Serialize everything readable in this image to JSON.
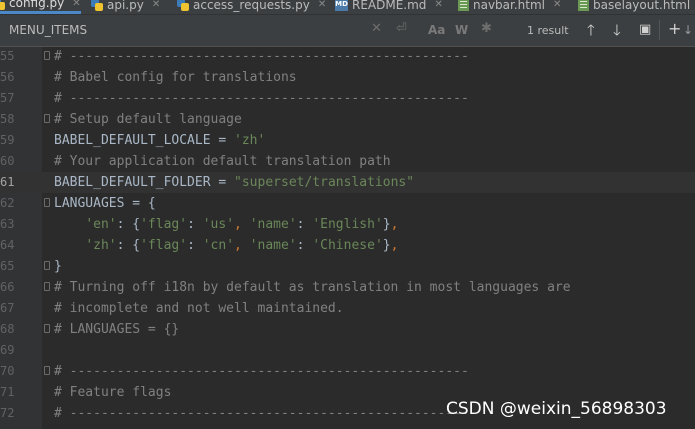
{
  "tabs": [
    {
      "label": "config.py",
      "icon": "python-file-icon",
      "active": true
    },
    {
      "label": "api.py",
      "icon": "python-file-icon"
    },
    {
      "label": "access_requests.py",
      "icon": "python-file-icon"
    },
    {
      "label": "README.md",
      "icon": "markdown-file-icon"
    },
    {
      "label": "navbar.html",
      "icon": "html-file-icon"
    },
    {
      "label": "baselayout.html",
      "icon": "html-file-icon"
    }
  ],
  "search": {
    "query": "MENU_ITEMS",
    "result_count": "1 result",
    "case_label": "Aa",
    "words_label": "W",
    "regex_label": "✱"
  },
  "editor": {
    "current_line": "61",
    "lines": [
      {
        "num": "55",
        "text": "# ---------------------------------------------------"
      },
      {
        "num": "56",
        "text": "# Babel config for translations"
      },
      {
        "num": "57",
        "text": "# ---------------------------------------------------"
      },
      {
        "num": "58",
        "text": "# Setup default language"
      },
      {
        "num": "59",
        "var": "BABEL_DEFAULT_LOCALE",
        "op": " = ",
        "str": "'zh'"
      },
      {
        "num": "60",
        "text": "# Your application default translation path"
      },
      {
        "num": "61",
        "var": "BABEL_DEFAULT_FOLDER",
        "op": " = ",
        "str": "\"superset/translations\""
      },
      {
        "num": "62",
        "text": "LANGUAGES = {"
      },
      {
        "num": "63",
        "k1": "'en'",
        "v1": "'us'",
        "v2": "'English'"
      },
      {
        "num": "64",
        "k1": "'zh'",
        "v1": "'cn'",
        "v2": "'Chinese'"
      },
      {
        "num": "65",
        "text": "}"
      },
      {
        "num": "66",
        "text": "# Turning off i18n by default as translation in most languages are"
      },
      {
        "num": "67",
        "text": "# incomplete and not well maintained."
      },
      {
        "num": "68",
        "text": "# LANGUAGES = {}"
      },
      {
        "num": "69",
        "text": ""
      },
      {
        "num": "70",
        "text": "# ---------------------------------------------------"
      },
      {
        "num": "71",
        "text": "# Feature flags"
      },
      {
        "num": "72",
        "text": "# ---------------------------------------------------"
      }
    ],
    "flag_key": "'flag'",
    "name_key": "'name'"
  },
  "watermark": "CSDN @weixin_56898303"
}
